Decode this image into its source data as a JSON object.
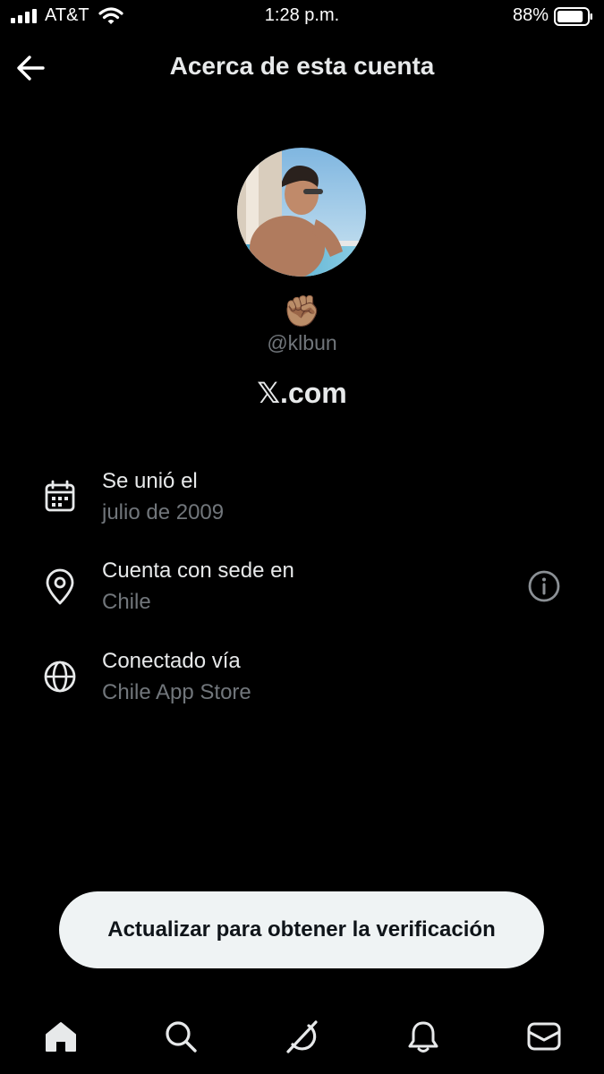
{
  "status_bar": {
    "carrier": "AT&T",
    "time": "1:28 p.m.",
    "battery_percent": "88%",
    "battery_level": 0.88
  },
  "header": {
    "title": "Acerca de esta cuenta"
  },
  "profile": {
    "emoji": "✊🏽",
    "handle": "@klbun",
    "brand": "𝕏.com"
  },
  "details": [
    {
      "title": "Se unió el",
      "value": "julio de 2009",
      "icon": "calendar-icon"
    },
    {
      "title": "Cuenta con sede en",
      "value": "Chile",
      "icon": "location-pin-icon"
    },
    {
      "title": "Conectado vía",
      "value": "Chile App Store",
      "icon": "globe-icon"
    }
  ],
  "verify_button": {
    "label": "Actualizar para obtener la verificación"
  },
  "bottom_nav": [
    {
      "icon": "home-icon"
    },
    {
      "icon": "search-icon"
    },
    {
      "icon": "grok-icon"
    },
    {
      "icon": "bell-icon"
    },
    {
      "icon": "mail-icon"
    }
  ],
  "colors": {
    "background": "#000000",
    "primary_text": "#e7e9ea",
    "secondary_text": "#71767b",
    "button_bg": "#eff3f4",
    "button_text": "#0f1419"
  }
}
